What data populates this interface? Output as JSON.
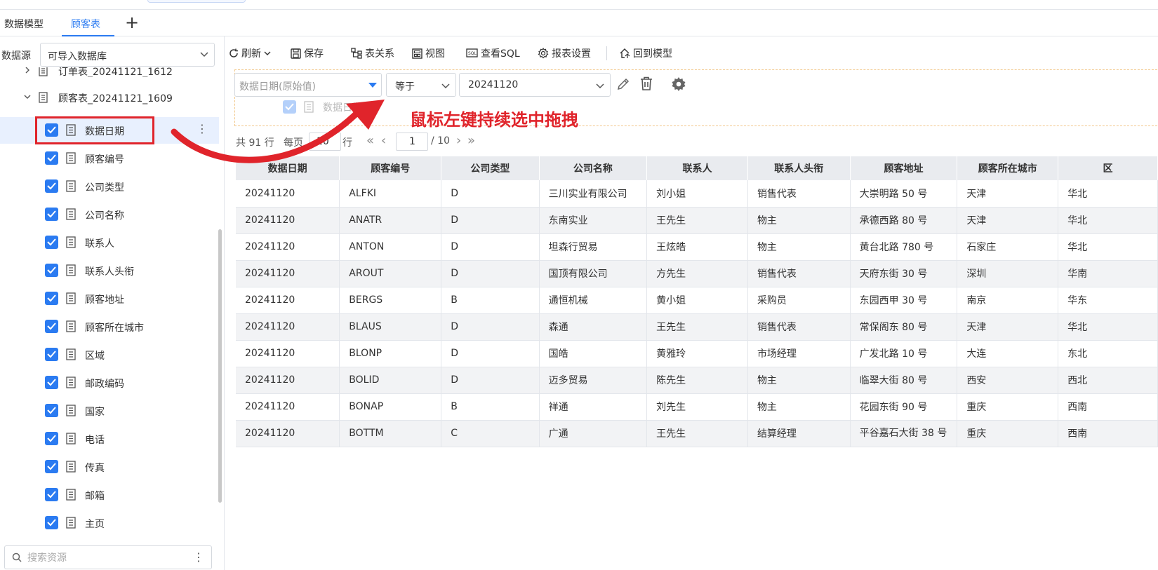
{
  "tabs": [
    {
      "label": "数据模型"
    },
    {
      "label": "顾客表"
    }
  ],
  "tab_add": "+",
  "sidebar": {
    "datasource_label": "数据源",
    "datasource_value": "可导入数据库",
    "tree": [
      {
        "label": "订单表_20241121_1612"
      },
      {
        "label": "顾客表_20241121_1609"
      }
    ],
    "fields": [
      {
        "label": "数据日期"
      },
      {
        "label": "顾客编号"
      },
      {
        "label": "公司类型"
      },
      {
        "label": "公司名称"
      },
      {
        "label": "联系人"
      },
      {
        "label": "联系人头衔"
      },
      {
        "label": "顾客地址"
      },
      {
        "label": "顾客所在城市"
      },
      {
        "label": "区域"
      },
      {
        "label": "邮政编码"
      },
      {
        "label": "国家"
      },
      {
        "label": "电话"
      },
      {
        "label": "传真"
      },
      {
        "label": "邮箱"
      },
      {
        "label": "主页"
      }
    ],
    "search_placeholder": "搜索资源",
    "kebab": "⋮"
  },
  "toolbar": {
    "refresh": "刷新",
    "save": "保存",
    "relation": "表关系",
    "view": "视图",
    "sql": "查看SQL",
    "report_settings": "报表设置",
    "back_to_model": "回到模型"
  },
  "filter": {
    "field": "数据日期(原始值)",
    "operator": "等于",
    "value": "20241120",
    "drag_ghost_label": "数据日期"
  },
  "annotation": "鼠标左键持续选中拖拽",
  "pagination": {
    "total": "共 91 行",
    "per_page_label": "每页",
    "per_page": "10",
    "row_unit": "行",
    "current_page": "1",
    "total_pages": "/ 10"
  },
  "table": {
    "columns": [
      "数据日期",
      "顾客编号",
      "公司类型",
      "公司名称",
      "联系人",
      "联系人头衔",
      "顾客地址",
      "顾客所在城市",
      "区"
    ],
    "rows": [
      [
        "20241120",
        "ALFKI",
        "D",
        "三川实业有限公司",
        "刘小姐",
        "销售代表",
        "大崇明路 50 号",
        "天津",
        "华北"
      ],
      [
        "20241120",
        "ANATR",
        "D",
        "东南实业",
        "王先生",
        "物主",
        "承德西路 80 号",
        "天津",
        "华北"
      ],
      [
        "20241120",
        "ANTON",
        "D",
        "坦森行贸易",
        "王炫皓",
        "物主",
        "黄台北路 780 号",
        "石家庄",
        "华北"
      ],
      [
        "20241120",
        "AROUT",
        "D",
        "国顶有限公司",
        "方先生",
        "销售代表",
        "天府东街 30 号",
        "深圳",
        "华南"
      ],
      [
        "20241120",
        "BERGS",
        "B",
        "通恒机械",
        "黄小姐",
        "采购员",
        "东园西甲 30 号",
        "南京",
        "华东"
      ],
      [
        "20241120",
        "BLAUS",
        "D",
        "森通",
        "王先生",
        "销售代表",
        "常保阁东 80 号",
        "天津",
        "华北"
      ],
      [
        "20241120",
        "BLONP",
        "D",
        "国皓",
        "黄雅玲",
        "市场经理",
        "广发北路 10 号",
        "大连",
        "东北"
      ],
      [
        "20241120",
        "BOLID",
        "D",
        "迈多贸易",
        "陈先生",
        "物主",
        "临翠大街 80 号",
        "西安",
        "西北"
      ],
      [
        "20241120",
        "BONAP",
        "B",
        "祥通",
        "刘先生",
        "物主",
        "花园东街 90 号",
        "重庆",
        "西南"
      ],
      [
        "20241120",
        "BOTTM",
        "C",
        "广通",
        "王先生",
        "结算经理",
        "平谷嘉石大街 38 号",
        "重庆",
        "西南"
      ]
    ]
  },
  "colors": {
    "accent": "#2b7bf1",
    "annotation_red": "#e0242b",
    "selected_row_bg": "#e8f0fe",
    "header_bg": "#e9ebef"
  }
}
